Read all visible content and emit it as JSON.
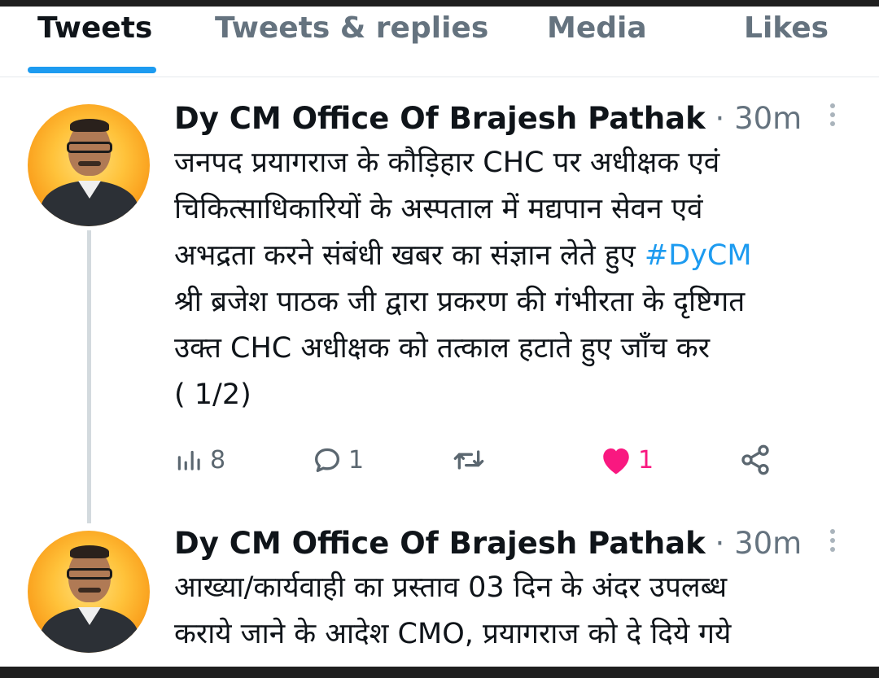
{
  "tabs": [
    {
      "label": "Tweets",
      "active": true
    },
    {
      "label": "Tweets & replies",
      "active": false
    },
    {
      "label": "Media",
      "active": false
    },
    {
      "label": "Likes",
      "active": false
    }
  ],
  "tweets": [
    {
      "author": "Dy CM Office Of Brajesh Pathak",
      "separator": "·",
      "time": "30m",
      "text_before_tag": "जनपद प्रयागराज के कौड़िहार CHC पर अधीक्षक एवं\nचिकित्साधिकारियों  के अस्पताल में मद्यपान सेवन एवं\nअभद्रता करने संबंधी खबर का संज्ञान लेते हुए ",
      "hashtag": "#DyCM",
      "text_after_tag": "\nश्री ब्रजेश पाठक जी द्वारा प्रकरण की गंभीरता के दृष्टिगत\nउक्त CHC अधीक्षक को तत्काल हटाते हुए जाँच कर\n( 1/2)",
      "stats": {
        "views": "8",
        "replies": "1",
        "likes": "1"
      },
      "icons": [
        "views-icon",
        "reply-icon",
        "retweet-icon",
        "like-icon",
        "share-icon"
      ]
    },
    {
      "author": "Dy CM Office Of Brajesh Pathak",
      "separator": "·",
      "time": "30m",
      "text": "आख्या/कार्यवाही का प्रस्ताव 03 दिन के अंदर उपलब्ध\nकराये जाने के आदेश CMO, प्रयागराज को दे दिये गये"
    }
  ],
  "colors": {
    "accent": "#1d9bf0",
    "like": "#f91880",
    "muted": "#65737f"
  }
}
